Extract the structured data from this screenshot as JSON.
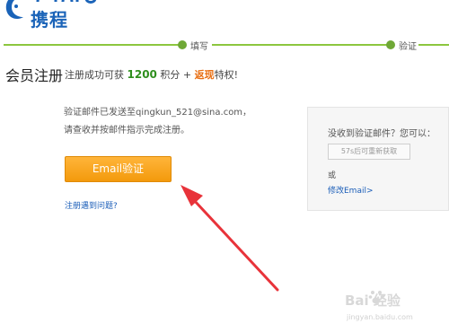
{
  "brand": {
    "name": "携程"
  },
  "progress": {
    "steps": [
      {
        "label": "填写"
      },
      {
        "label": "验证"
      }
    ]
  },
  "page": {
    "title": "会员注册"
  },
  "promo": {
    "prefix": "注册成功可获",
    "points": "1200",
    "points_unit": "积分",
    "plus": "+",
    "cashback": "返现",
    "suffix": "特权!"
  },
  "info": {
    "line1": "验证邮件已发送至qingkun_521@sina.com，",
    "line2": "请查收并按邮件指示完成注册。"
  },
  "email_button": {
    "label": "Email验证"
  },
  "help_link": {
    "label": "注册遇到问题?"
  },
  "side": {
    "title": "没收到验证邮件？您可以：",
    "resend_label": "57s后可重新获取",
    "or": "或",
    "modify_label": "修改Email>"
  },
  "watermark": {
    "main": "Bai 经验",
    "sub": "jingyan.baidu.com"
  },
  "colors": {
    "brand_blue": "#1a63b8",
    "progress_green": "#8cc63f",
    "button_orange": "#f39a0c",
    "arrow_red": "#e8333a"
  }
}
